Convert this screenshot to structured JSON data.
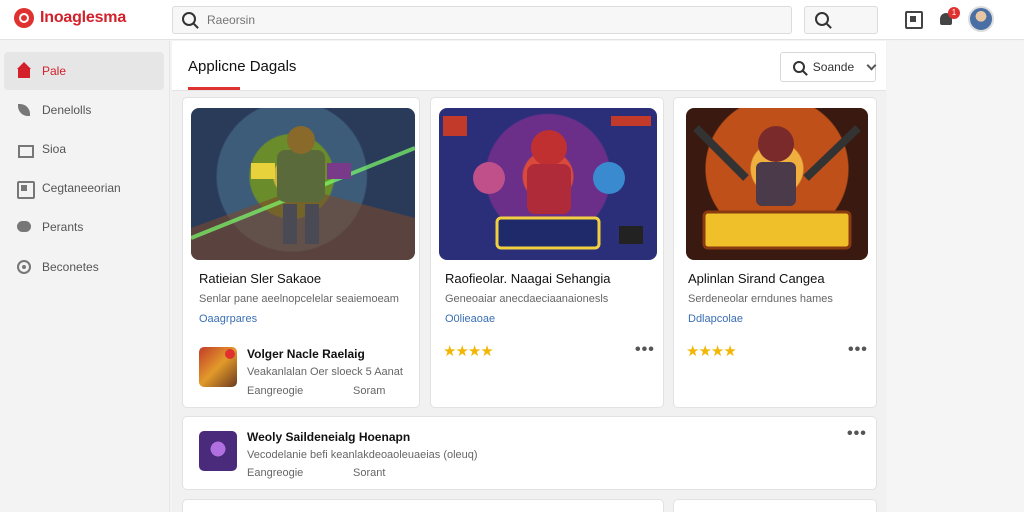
{
  "app": {
    "name": "Inoaglesma"
  },
  "search": {
    "placeholder": "Raeorsin",
    "button_icon": "search-icon"
  },
  "topbar": {
    "notification_count": "1"
  },
  "sidebar": {
    "items": [
      {
        "label": "Pale",
        "icon": "home-icon",
        "active": true
      },
      {
        "label": "Denelolls",
        "icon": "leaf-icon"
      },
      {
        "label": "Sioa",
        "icon": "stack-icon"
      },
      {
        "label": "Cegtaneeorian",
        "icon": "box-icon"
      },
      {
        "label": "Perants",
        "icon": "chat-icon"
      },
      {
        "label": "Beconetes",
        "icon": "circle-icon"
      }
    ]
  },
  "main": {
    "title": "Applicne Dagals",
    "sort_label": "Soande",
    "cards": [
      {
        "title": "Ratieian Sler Sakaoe",
        "desc": "Senlar pane aeelnopcelelar seaiemoeam",
        "tag": "Oaagrpares",
        "sub": {
          "title": "Volger Nacle Raelaig",
          "line1": "Veakanlalan Oer sloeck 5 Aanat",
          "line2_left": "Eangreogie",
          "line2_right": "Soram"
        }
      },
      {
        "title": "Raofieolar. Naagai Sehangia",
        "desc": "Geneoaiar anecdaeciaanaionesls",
        "tag": "O0lieaoae",
        "stars": "★★★★",
        "more": "•••"
      },
      {
        "title": "Aplinlan Sirand Cangea",
        "desc": "Serdeneolar erndunes hames",
        "tag": "Ddlapcolae",
        "stars": "★★★★",
        "more": "•••"
      }
    ],
    "wide_item": {
      "title": "Weoly Saildeneialg Hoenapn",
      "line1": "Vecodelanie befi keanlakdeoaoleuaeias (oleuq)",
      "line2_left": "Eangreogie",
      "line2_right": "Sorant",
      "more": "•••"
    }
  },
  "colors": {
    "brand": "#d3202a",
    "accent": "#e03131",
    "link": "#3a6fb4",
    "star": "#f2b705"
  }
}
